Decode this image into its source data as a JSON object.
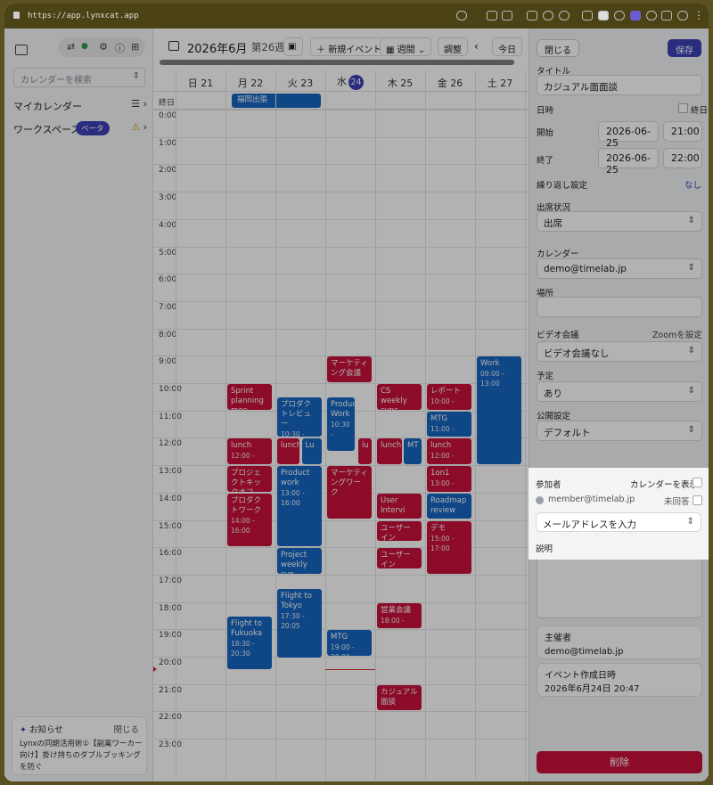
{
  "browser": {
    "url": "https://app.lynxcat.app"
  },
  "sidebar": {
    "search_placeholder": "カレンダーを検索",
    "my_calendar": "マイカレンダー",
    "workspace": "ワークスペース",
    "beta_badge": "ベータ",
    "notice": {
      "title": "お知らせ",
      "close": "閉じる",
      "body": "Lynxの同期活用術①【副業ワーカー向け】掛け持ちのダブルブッキングを防ぐ"
    }
  },
  "calendar": {
    "title": "2026年6月",
    "week": "第26週",
    "new_event": "新規イベント",
    "view": "週間",
    "adjust": "調整",
    "today": "今日",
    "all_day_label": "終日",
    "days": [
      "日 21",
      "月 22",
      "火 23",
      "水",
      "木 25",
      "金 26",
      "土 27"
    ],
    "today_num": "24",
    "hours": [
      "0:00",
      "1:00",
      "2:00",
      "3:00",
      "4:00",
      "5:00",
      "6:00",
      "7:00",
      "8:00",
      "9:00",
      "10:00",
      "11:00",
      "12:00",
      "13:00",
      "14:00",
      "15:00",
      "16:00",
      "17:00",
      "18:00",
      "19:00",
      "20:00",
      "21:00",
      "22:00",
      "23:00"
    ],
    "all_day_event": "福岡出張",
    "events": [
      {
        "title": "Sprint planning mee",
        "time": "",
        "color": "red"
      },
      {
        "title": "lunch",
        "time": "12:00 -",
        "color": "red"
      },
      {
        "title": "プロジェクトキックオフ",
        "time": "",
        "color": "red"
      },
      {
        "title": "プロダクトワーク",
        "time": "14:00 - 16:00",
        "color": "red"
      },
      {
        "title": "Flight to Fukuoka",
        "time": "18:30 - 20:30",
        "color": "blue"
      },
      {
        "title": "プロダクトレビュー",
        "time": "10:30 - 12:00",
        "color": "blue"
      },
      {
        "title": "lunch",
        "time": "",
        "color": "red"
      },
      {
        "title": "Lu",
        "time": "",
        "color": "blue"
      },
      {
        "title": "Product work",
        "time": "13:00 - 16:00",
        "color": "blue"
      },
      {
        "title": "Project weekly syn",
        "time": "",
        "color": "blue"
      },
      {
        "title": "Flight to Tokyo",
        "time": "17:30 - 20:05",
        "color": "blue"
      },
      {
        "title": "マーケティング会議",
        "time": "",
        "color": "red"
      },
      {
        "title": "Product Work",
        "time": "10:30 -",
        "color": "blue"
      },
      {
        "title": "lu",
        "time": "",
        "color": "red"
      },
      {
        "title": "マーケティングワーク",
        "time": "",
        "color": "red"
      },
      {
        "title": "MTG",
        "time": "19:00 - 20:00",
        "color": "blue"
      },
      {
        "title": "CS weekly sync",
        "time": "",
        "color": "red"
      },
      {
        "title": "lunch",
        "time": "",
        "color": "red"
      },
      {
        "title": "MT",
        "time": "",
        "color": "blue"
      },
      {
        "title": "User Intervi",
        "time": "",
        "color": "red"
      },
      {
        "title": "ユーザーイン",
        "time": "15:00 -",
        "color": "red"
      },
      {
        "title": "ユーザーイン",
        "time": "16:00 -",
        "color": "red"
      },
      {
        "title": "営業会議",
        "time": "18:00 -",
        "color": "red"
      },
      {
        "title": "カジュアル面談",
        "time": "",
        "color": "red"
      },
      {
        "title": "レポート",
        "time": "10:00 -",
        "color": "red"
      },
      {
        "title": "MTG",
        "time": "11:00 -",
        "color": "blue"
      },
      {
        "title": "lunch",
        "time": "12:00 -",
        "color": "red"
      },
      {
        "title": "1on1",
        "time": "13:00 -",
        "color": "red"
      },
      {
        "title": "Roadmap review",
        "time": "",
        "color": "blue"
      },
      {
        "title": "デモ",
        "time": "15:00 - 17:00",
        "color": "red"
      },
      {
        "title": "Work",
        "time": "09:00 - 13:00",
        "color": "blue"
      }
    ]
  },
  "panel": {
    "close": "閉じる",
    "save": "保存",
    "title_label": "タイトル",
    "title_value": "カジュアル面面談",
    "all_day_label": "日時",
    "all_day_check": "終日",
    "start_label": "開始",
    "start_date": "2026-06-25",
    "start_time": "21:00",
    "end_label": "終了",
    "end_date": "2026-06-25",
    "end_time": "22:00",
    "repeat_label": "繰り返し設定",
    "repeat_value": "なし",
    "attendance_label": "出席状況",
    "attendance_value": "出席",
    "calendar_label": "カレンダー",
    "calendar_value": "demo@timelab.jp",
    "location_label": "場所",
    "video_label": "ビデオ会議",
    "zoom_settings": "Zoomを設定",
    "video_value": "ビデオ会議なし",
    "schedule_label": "予定",
    "schedule_value": "あり",
    "visibility_label": "公開設定",
    "visibility_value": "デフォルト",
    "participants_label": "参加者",
    "show_calendar": "カレンダーを表示",
    "member_email": "member@timelab.jp",
    "member_status": "未回答",
    "email_placeholder": "メールアドレスを入力",
    "description_label": "説明",
    "organizer_label": "主催者",
    "organizer_value": "demo@timelab.jp",
    "created_label": "イベント作成日時",
    "created_value": "2026年6月24日 20:47",
    "delete": "削除"
  },
  "colors": {
    "accent": "#3d3fb5",
    "event_red": "#c8113a",
    "event_blue": "#1565c0"
  }
}
